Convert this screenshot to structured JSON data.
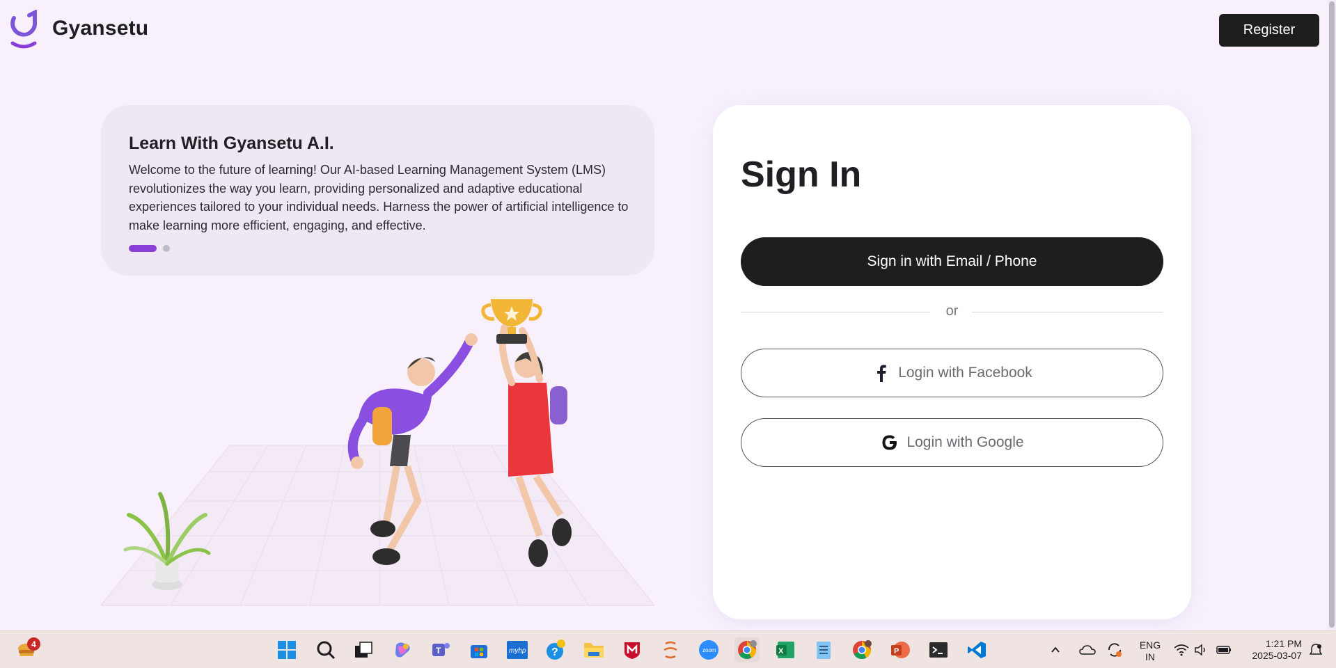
{
  "header": {
    "brand": "Gyansetu",
    "register_label": "Register"
  },
  "info_card": {
    "title": "Learn With Gyansetu A.I.",
    "text": "Welcome to the future of learning! Our AI-based Learning Management System (LMS) revolutionizes the way you learn, providing personalized and adaptive educational experiences tailored to your individual needs. Harness the power of artificial intelligence to make learning more efficient, engaging, and effective.",
    "active_slide": 1,
    "slide_count": 2
  },
  "signin": {
    "title": "Sign In",
    "email_button": "Sign in with Email / Phone",
    "or_text": "or",
    "facebook_button": "Login with Facebook",
    "google_button": "Login with Google"
  },
  "taskbar": {
    "notification_count": "4",
    "language_line1": "ENG",
    "language_line2": "IN",
    "time": "1:21 PM",
    "date": "2025-03-07",
    "apps": [
      "windows-start",
      "search",
      "task-view",
      "copilot",
      "teams",
      "store",
      "myhp",
      "get-help",
      "file-explorer",
      "mcafee",
      "app",
      "zoom",
      "chrome",
      "excel",
      "notepad",
      "chrome-2",
      "powerpoint",
      "terminal",
      "vscode"
    ]
  },
  "colors": {
    "background": "#f8f1fc",
    "accent": "#8a3ed8",
    "primary_button": "#1e1e1e",
    "card": "#ffffff"
  }
}
